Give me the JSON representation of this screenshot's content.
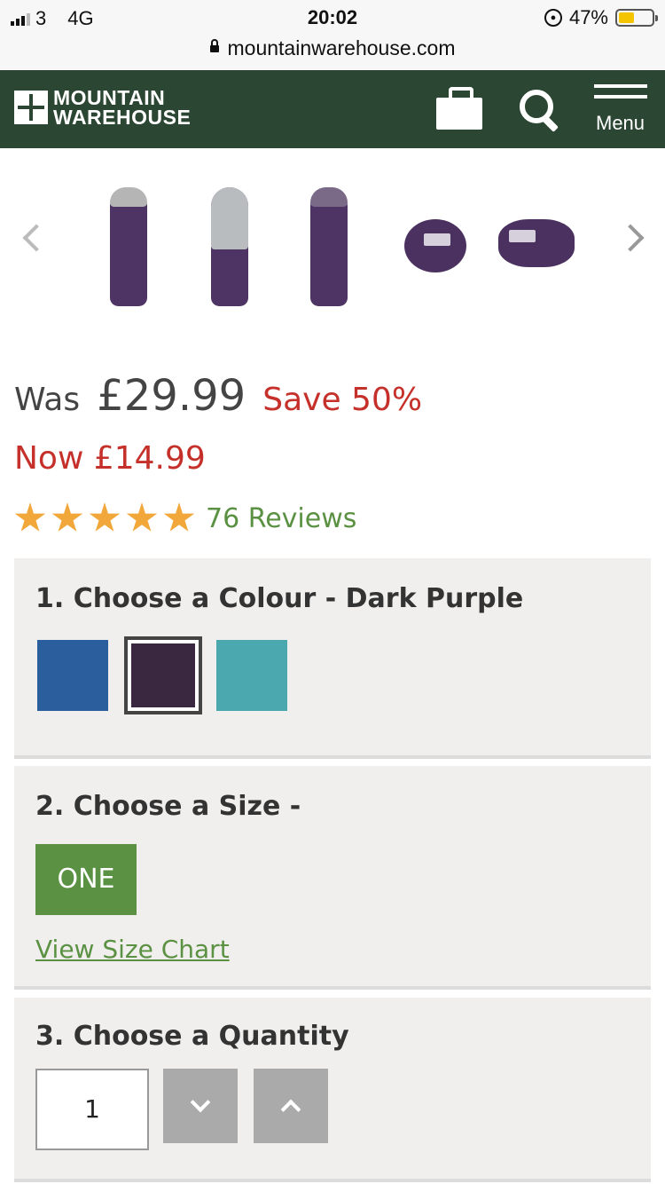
{
  "status_bar": {
    "carrier": "3",
    "network": "4G",
    "time": "20:02",
    "battery": "47%",
    "battery_level": 0.47
  },
  "browser": {
    "url": "mountainwarehouse.com"
  },
  "header": {
    "logo_line1": "MOUNTAIN",
    "logo_line2": "WAREHOUSE",
    "menu_label": "Menu",
    "background_color": "#2b4632"
  },
  "gallery": {
    "thumbnails": [
      "sleeping-bag-closed",
      "sleeping-bag-open",
      "sleeping-bag-back",
      "sleeping-bag-packed-round",
      "sleeping-bag-packed-side"
    ]
  },
  "price": {
    "was_label": "Was",
    "was_price": "£29.99",
    "save": "Save 50%",
    "now": "Now £14.99"
  },
  "rating": {
    "stars": 5,
    "reviews": "76 Reviews"
  },
  "colour_panel": {
    "title": "1. Choose a Colour - Dark Purple",
    "swatches": [
      {
        "name": "blue",
        "color": "#2a5e9c"
      },
      {
        "name": "dark-purple",
        "color": "#3a2740",
        "selected": true
      },
      {
        "name": "teal",
        "color": "#4aa8ae"
      }
    ]
  },
  "size_panel": {
    "title": "2. Choose a Size -",
    "option": "ONE",
    "size_chart_link": "View Size Chart"
  },
  "quantity_panel": {
    "title": "3. Choose a Quantity",
    "value": "1"
  },
  "colors": {
    "accent_green": "#5a9142",
    "sale_red": "#c5302a",
    "star": "#f2a73b"
  }
}
